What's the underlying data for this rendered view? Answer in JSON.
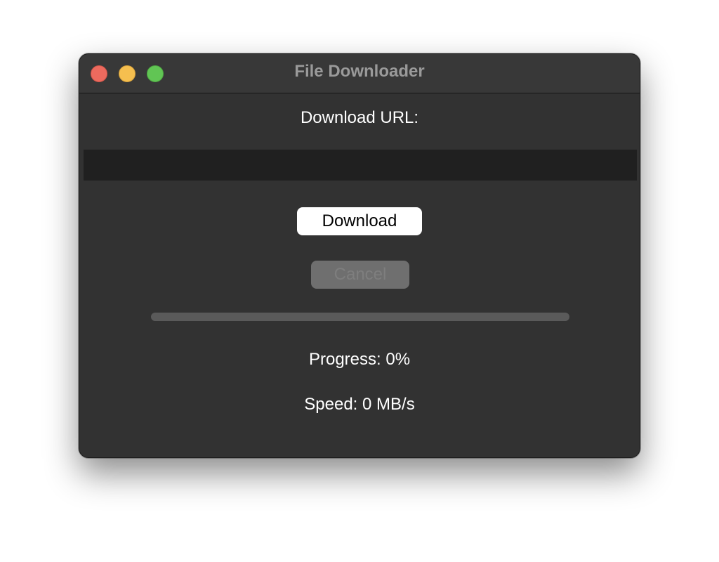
{
  "window": {
    "title": "File Downloader"
  },
  "form": {
    "url_label": "Download URL:",
    "url_value": "",
    "url_placeholder": ""
  },
  "buttons": {
    "download_label": "Download",
    "cancel_label": "Cancel",
    "cancel_enabled": false
  },
  "status": {
    "progress_percent": 0,
    "progress_text": "Progress: 0%",
    "speed_text": "Speed: 0 MB/s"
  },
  "colors": {
    "close": "#ed6a5e",
    "minimize": "#f5bf4f",
    "zoom": "#61c554",
    "window_bg": "#323232"
  }
}
